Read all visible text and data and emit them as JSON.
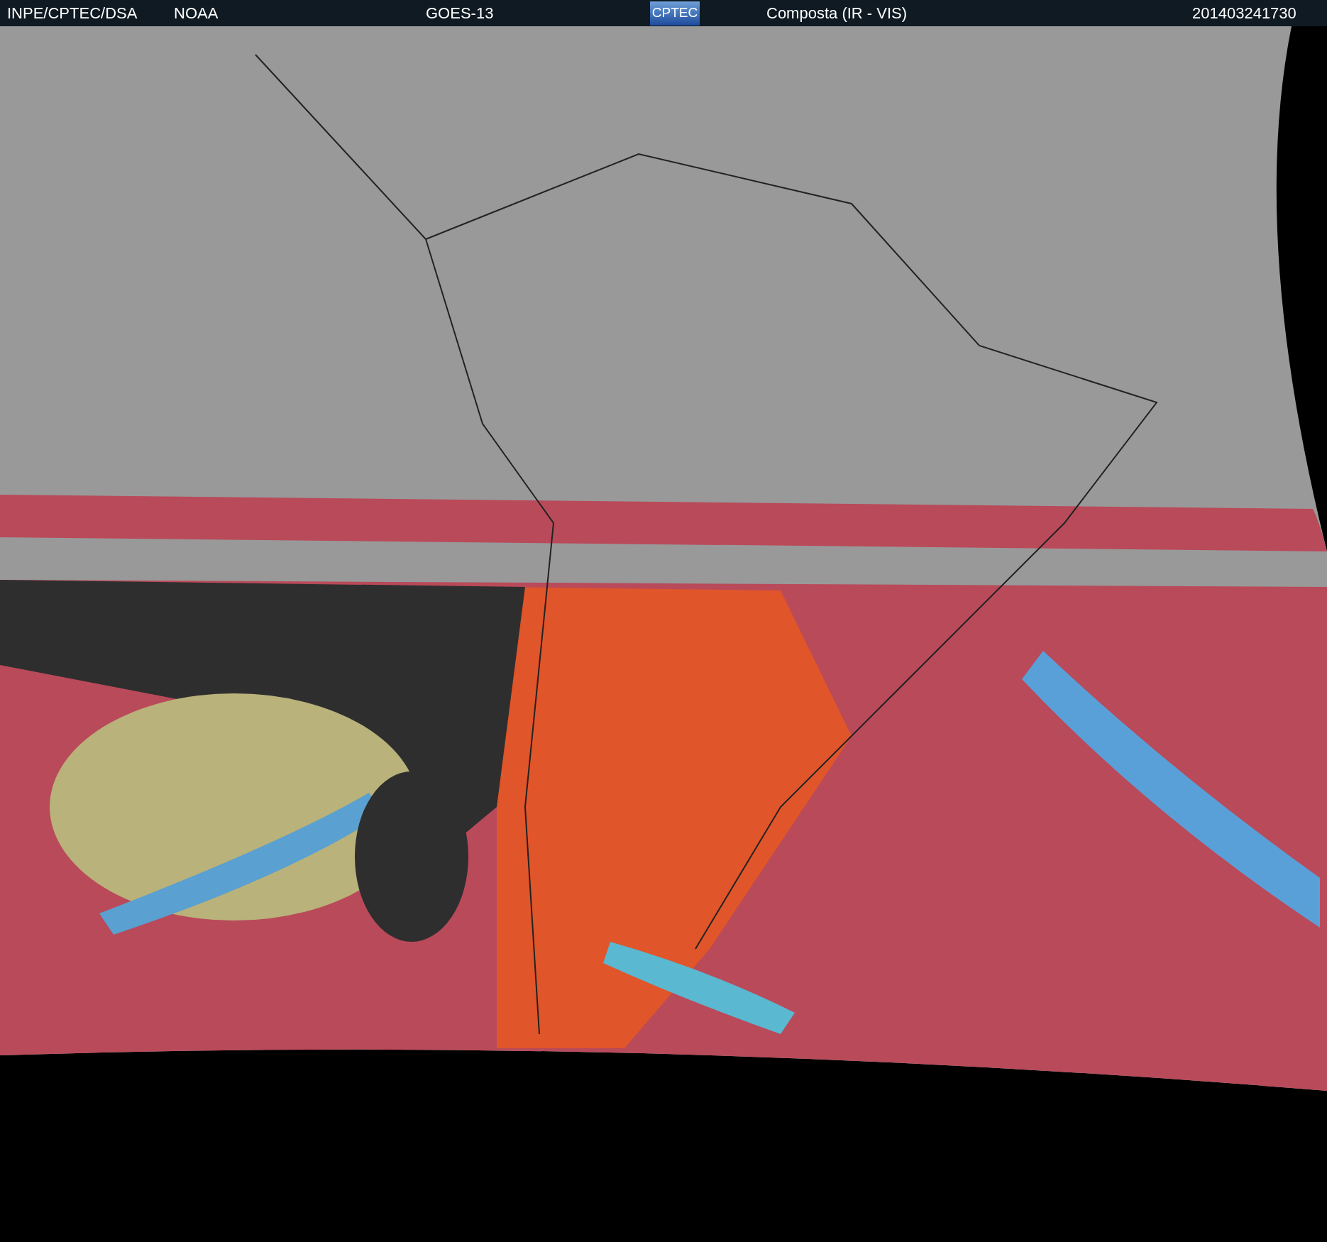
{
  "header": {
    "source": "INPE/CPTEC/DSA",
    "agency": "NOAA",
    "satellite": "GOES-13",
    "logo": "CPTEC",
    "product": "Composta (IR - VIS)",
    "timestamp": "201403241730"
  }
}
